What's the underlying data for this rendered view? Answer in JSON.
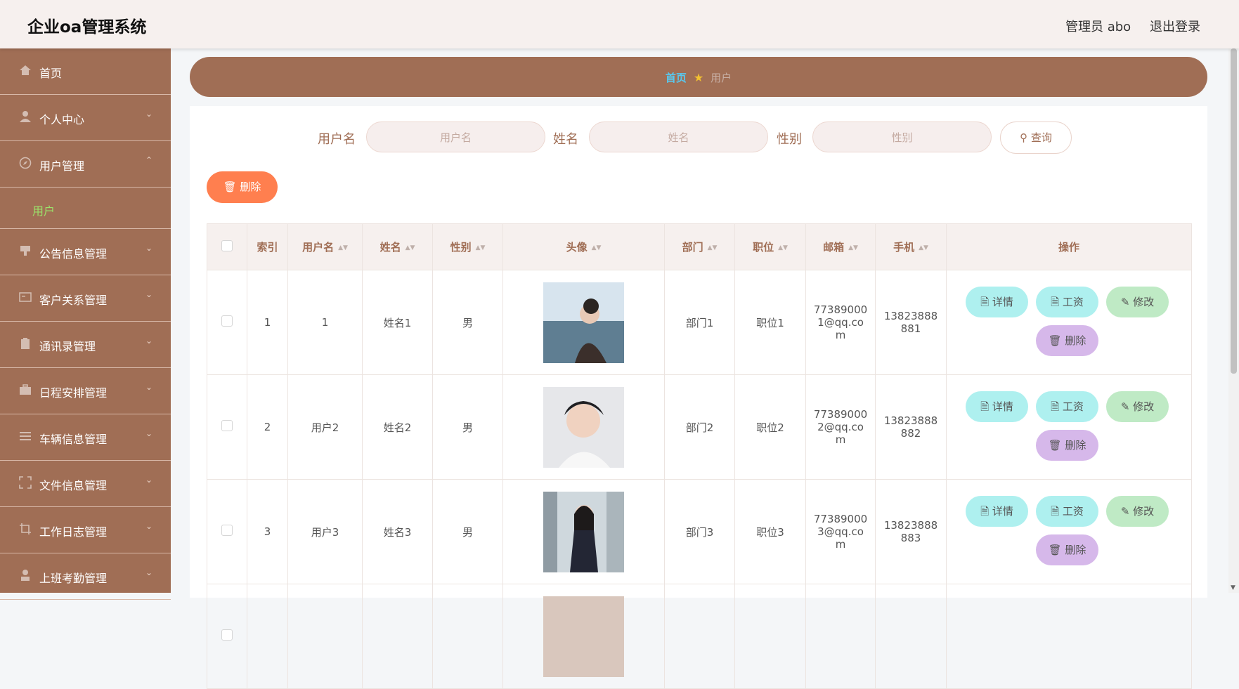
{
  "header": {
    "app_title": "企业oa管理系统",
    "admin_text": "管理员 abo",
    "logout": "退出登录"
  },
  "sidebar": {
    "items": [
      {
        "label": "首页",
        "icon": "home-icon"
      },
      {
        "label": "个人中心",
        "icon": "user-icon"
      },
      {
        "label": "用户管理",
        "icon": "compass-icon",
        "expanded": true,
        "children": [
          "用户"
        ]
      },
      {
        "label": "公告信息管理",
        "icon": "notice-icon"
      },
      {
        "label": "客户关系管理",
        "icon": "card-icon"
      },
      {
        "label": "通讯录管理",
        "icon": "clipboard-icon"
      },
      {
        "label": "日程安排管理",
        "icon": "briefcase-icon"
      },
      {
        "label": "车辆信息管理",
        "icon": "list-icon"
      },
      {
        "label": "文件信息管理",
        "icon": "fullscreen-icon"
      },
      {
        "label": "工作日志管理",
        "icon": "crop-icon"
      },
      {
        "label": "上班考勤管理",
        "icon": "person-icon"
      }
    ]
  },
  "breadcrumb": {
    "home": "首页",
    "current": "用户"
  },
  "search": {
    "username_label": "用户名",
    "username_placeholder": "用户名",
    "name_label": "姓名",
    "name_placeholder": "姓名",
    "gender_label": "性别",
    "gender_placeholder": "性别",
    "query_button": "查询"
  },
  "actions": {
    "delete_button": "删除"
  },
  "table": {
    "columns": [
      "索引",
      "用户名",
      "姓名",
      "性别",
      "头像",
      "部门",
      "职位",
      "邮箱",
      "手机",
      "操作"
    ],
    "rows": [
      {
        "index": "1",
        "username": "1",
        "name": "姓名1",
        "gender": "男",
        "dept": "部门1",
        "position": "职位1",
        "email_lines": [
          "77389000",
          "1@qq.co",
          "m"
        ],
        "phone_lines": [
          "13823888",
          "881"
        ]
      },
      {
        "index": "2",
        "username": "用户2",
        "name": "姓名2",
        "gender": "男",
        "dept": "部门2",
        "position": "职位2",
        "email_lines": [
          "77389000",
          "2@qq.co",
          "m"
        ],
        "phone_lines": [
          "13823888",
          "882"
        ]
      },
      {
        "index": "3",
        "username": "用户3",
        "name": "姓名3",
        "gender": "男",
        "dept": "部门3",
        "position": "职位3",
        "email_lines": [
          "77389000",
          "3@qq.co",
          "m"
        ],
        "phone_lines": [
          "13823888",
          "883"
        ]
      }
    ],
    "row_actions": {
      "detail": "详情",
      "salary": "工资",
      "edit": "修改",
      "delete": "删除"
    }
  },
  "colors": {
    "brand": "#a06e55",
    "danger": "#ff7f4f",
    "active_sub": "#9be36a",
    "crumb_home": "#59c8ee"
  }
}
